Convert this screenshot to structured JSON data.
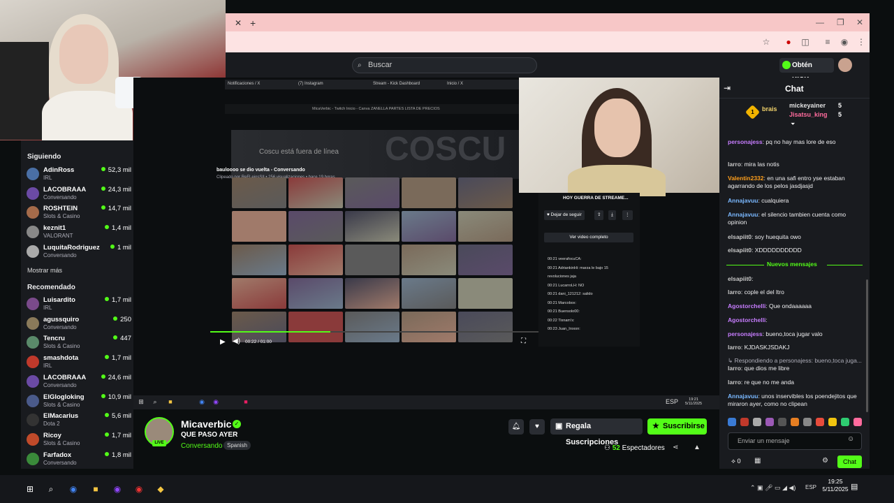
{
  "browser": {
    "tab_close": "✕",
    "new_tab": "+",
    "window_controls": [
      "—",
      "❐",
      "✕"
    ]
  },
  "kick": {
    "search_placeholder": "Buscar",
    "kicks_button": "Obtén KICKs"
  },
  "sidebar": {
    "following_header": "Siguiendo",
    "following": [
      {
        "name": "AdinRoss",
        "category": "IRL",
        "viewers": "52,3 mil",
        "color": "#4a6fa5"
      },
      {
        "name": "LACOBRAAA",
        "category": "Conversando",
        "viewers": "24,3 mil",
        "color": "#6b4aa5"
      },
      {
        "name": "ROSHTEIN",
        "category": "Slots & Casino",
        "viewers": "14,7 mil",
        "color": "#a56b4a"
      },
      {
        "name": "keznit1",
        "category": "VALORANT",
        "viewers": "1,4 mil",
        "color": "#888888"
      },
      {
        "name": "LuquitaRodriguez",
        "category": "Conversando",
        "viewers": "1 mil",
        "color": "#aaaaaa"
      }
    ],
    "show_more": "Mostrar más",
    "recommended_header": "Recomendado",
    "recommended": [
      {
        "name": "Luisardito",
        "category": "IRL",
        "viewers": "1,7 mil",
        "color": "#7a4a8a"
      },
      {
        "name": "agussquiro",
        "category": "Conversando",
        "viewers": "250",
        "color": "#8a7a5a"
      },
      {
        "name": "Tencru",
        "category": "Slots & Casino",
        "viewers": "447",
        "color": "#5a8a6a"
      },
      {
        "name": "smashdota",
        "category": "IRL",
        "viewers": "1,7 mil",
        "color": "#c0392b"
      },
      {
        "name": "LACOBRAAA",
        "category": "Conversando",
        "viewers": "24,6 mil",
        "color": "#6b4aa5"
      },
      {
        "name": "ElGlogloking",
        "category": "Slots & Casino",
        "viewers": "10,9 mil",
        "color": "#4a5a8a"
      },
      {
        "name": "ElMacarius",
        "category": "Dota 2",
        "viewers": "5,6 mil",
        "color": "#333333"
      },
      {
        "name": "Ricoy",
        "category": "Slots & Casino",
        "viewers": "1,7 mil",
        "color": "#c04a2a"
      },
      {
        "name": "Farfadox",
        "category": "Conversando",
        "viewers": "1,8 mil",
        "color": "#3a8a3a"
      }
    ]
  },
  "stream": {
    "inner_tabs": [
      "Notificaciones / X",
      "(7) Instagram",
      "Stream - Kick Dashboard",
      "Inicio / X"
    ],
    "bookmarks": "MicaVerbic - Twitch   Inicio - Canva   ZANELLA PARTES   LISTA DE PRECIOS",
    "offline_text": "Coscu está fuera de línea",
    "offline_logo": "COSCU",
    "clip_title": "bauloooo se dio vuelta - Conversando",
    "clip_by": "Clipeado por ReFLejosSII • 256 visualizaciones • hace 19 horas",
    "time": "00:22 / 01:00",
    "panel_title": "HOY GUERRA DE STREAME...",
    "follow_btn": "Dejar de seguir",
    "full_video": "Ver video completo",
    "mini_chat": [
      "00:21 veerafocuCA:",
      "00:21 AdriankinHi: marza le bajo 15",
      "revoluciones jaja",
      "00:21 LucarroLH: NO",
      "00:21 dani_121212: salido",
      "00:21 Marcobox:",
      "00:21 Buensolo00:",
      "00:22 Tixnam's:",
      "00:23 Juan_Irxxon:"
    ],
    "taskbar_clock": "19:21\n5/11/2025",
    "taskbar_lang": "ESP"
  },
  "channel": {
    "name": "Micaverbic",
    "title": "QUE PASO AYER",
    "category": "Conversando",
    "language": "Spanish",
    "live": "LIVE",
    "gift_button": "Regala Suscripciones",
    "subscribe_button": "Suscribirse",
    "viewers": "52",
    "viewers_label": "Espectadores"
  },
  "chat": {
    "title": "Chat",
    "pinned": [
      {
        "user": "brais",
        "color": "#f2d36b"
      },
      {
        "user": "mickeyainer",
        "color": "#e0e0e0",
        "count": "5"
      },
      {
        "user": "Jisatsu_king",
        "color": "#ff6b9d",
        "count": "5"
      }
    ],
    "rank_badge": "1",
    "messages": [
      {
        "user": "personajess",
        "color": "#c77dff",
        "text": ": pq no hay mas lore de eso"
      },
      {
        "user": "larro",
        "color": "#c8c8c8",
        "text": ": mira las notis"
      },
      {
        "user": "Valentin2332",
        "color": "#ff9f1c",
        "text": ": en una safi entro yse estaban agarrando de los pelos jasdjasjd"
      },
      {
        "user": "Annajavuu",
        "color": "#7ab8ff",
        "text": ": cualquiera"
      },
      {
        "user": "Annajavuu",
        "color": "#7ab8ff",
        "text": ": el silencio tambien cuenta como opinion"
      },
      {
        "user": "elsapiit0",
        "color": "#c8c8c8",
        "text": ": soy huequita owo"
      },
      {
        "user": "elsapiit0",
        "color": "#c8c8c8",
        "text": ": XDDDDDDDDDD"
      }
    ],
    "new_messages": "Nuevos mensajes",
    "messages2": [
      {
        "user": "elsapiit0",
        "color": "#c8c8c8",
        "text": ":"
      },
      {
        "user": "larro",
        "color": "#c8c8c8",
        "text": ": cople el del ltro"
      },
      {
        "user": "Agostorchelli",
        "color": "#c77dff",
        "text": ": Que ondaaaaaa"
      },
      {
        "user": "Agostorchelli",
        "color": "#c77dff",
        "text": ":"
      },
      {
        "user": "personajess",
        "color": "#c77dff",
        "text": ": bueno,toca jugar valo"
      },
      {
        "user": "larro",
        "color": "#c8c8c8",
        "text": ": KJDASKJSDAKJ"
      },
      {
        "user": "",
        "color": "#adadb8",
        "text": "↳ Respondiendo a personajess: bueno,toca juga..."
      },
      {
        "user": "larro",
        "color": "#c8c8c8",
        "text": ": que dios me libre"
      },
      {
        "user": "larro",
        "color": "#c8c8c8",
        "text": ": re que no me anda"
      },
      {
        "user": "Annajavuu",
        "color": "#7ab8ff",
        "text": ": unos inservibles los poendejitos que miraron ayer, como no clipean"
      }
    ],
    "input_placeholder": "Enviar un mensaje",
    "points": "0",
    "chat_button": "Chat"
  },
  "os": {
    "clock": "19:25\n5/11/2025",
    "lang": "ESP"
  }
}
